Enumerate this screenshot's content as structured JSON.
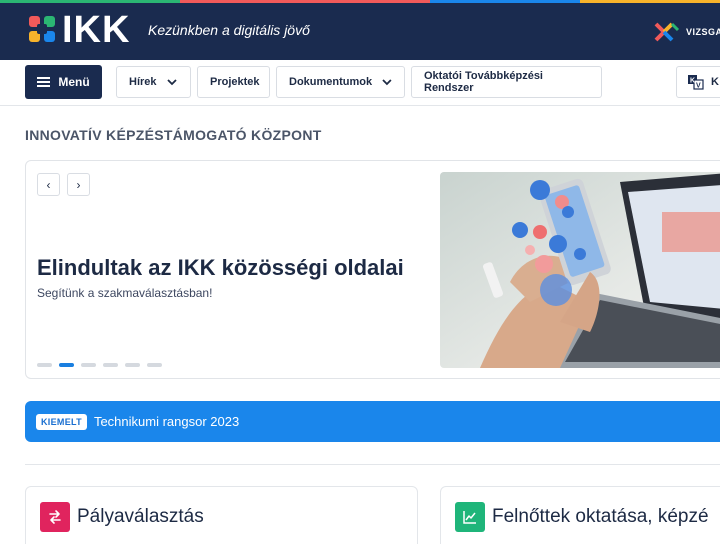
{
  "header": {
    "logo_text": "IKK",
    "slogan": "Kezünkben a digitális jövő",
    "vizsga_label": "VIZSGAI",
    "strip_colors": [
      "#2bb673",
      "#f15a5a",
      "#1a86eb",
      "#f7b32b"
    ]
  },
  "nav": {
    "menu_label": "Menü",
    "items": [
      {
        "label": "Hírek",
        "has_dropdown": true
      },
      {
        "label": "Projektek",
        "has_dropdown": false
      },
      {
        "label": "Dokumentumok",
        "has_dropdown": true
      },
      {
        "label": "Oktatói Továbbképzési Rendszer",
        "has_dropdown": false
      }
    ],
    "kv_label": "K"
  },
  "section": {
    "title": "INNOVATÍV KÉPZÉSTÁMOGATÓ KÖZPONT"
  },
  "slider": {
    "prev_icon": "‹",
    "next_icon": "›",
    "title": "Elindultak az IKK közösségi oldalai",
    "subtitle": "Segítünk a szakmaválasztásban!",
    "dot_count": 6,
    "active_dot": 1
  },
  "highlight": {
    "badge": "KIEMELT",
    "text": "Technikumi rangsor 2023",
    "color": "#1a86eb"
  },
  "cards": [
    {
      "title": "Pályaválasztás",
      "icon": "arrows-icon",
      "color": "#e0245e"
    },
    {
      "title": "Felnőttek oktatása, képzé",
      "icon": "chart-icon",
      "color": "#1fb57a"
    }
  ]
}
